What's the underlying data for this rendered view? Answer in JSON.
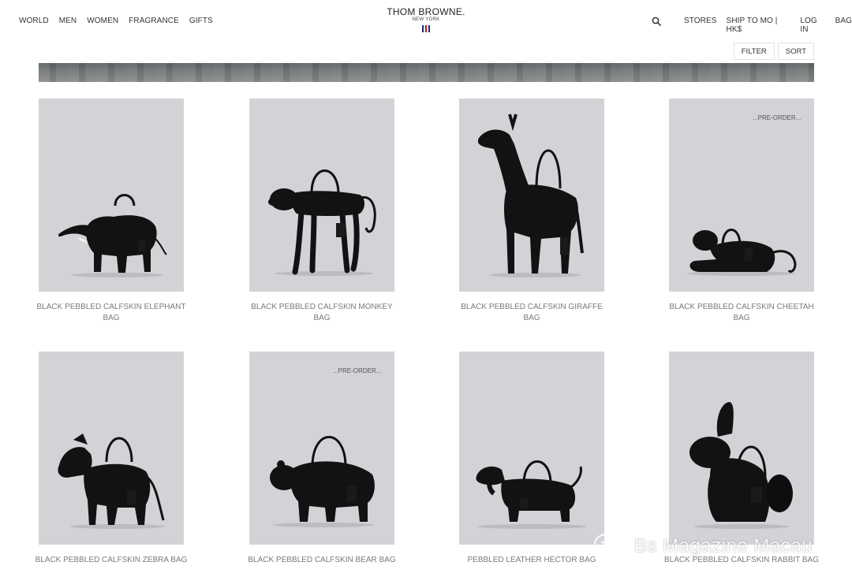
{
  "nav": {
    "left": [
      "WORLD",
      "MEN",
      "WOMEN",
      "FRAGRANCE",
      "GIFTS"
    ],
    "right": [
      "STORES",
      "SHIP TO MO | HK$",
      "LOG IN",
      "BAG"
    ]
  },
  "brand": {
    "name": "THOM BROWNE.",
    "sub": "NEW YORK"
  },
  "toolbar": {
    "filter": "FILTER",
    "sort": "SORT"
  },
  "products": [
    {
      "title": "BLACK PEBBLED CALFSKIN ELEPHANT BAG",
      "animal": "elephant",
      "badge": ""
    },
    {
      "title": "BLACK PEBBLED CALFSKIN MONKEY BAG",
      "animal": "monkey",
      "badge": ""
    },
    {
      "title": "BLACK PEBBLED CALFSKIN GIRAFFE BAG",
      "animal": "giraffe",
      "badge": ""
    },
    {
      "title": "BLACK PEBBLED CALFSKIN CHEETAH BAG",
      "animal": "cheetah",
      "badge": "...PRE-ORDER..."
    },
    {
      "title": "BLACK PEBBLED CALFSKIN ZEBRA BAG",
      "animal": "zebra",
      "badge": ""
    },
    {
      "title": "BLACK PEBBLED CALFSKIN BEAR BAG",
      "animal": "bear",
      "badge": "...PRE-ORDER..."
    },
    {
      "title": "PEBBLED LEATHER HECTOR BAG",
      "animal": "dachshund",
      "badge": ""
    },
    {
      "title": "BLACK PEBBLED CALFSKIN RABBIT BAG",
      "animal": "rabbit",
      "badge": ""
    }
  ],
  "watermark": {
    "text": "Bs Magazine Macau",
    "icon": "wechat-icon"
  },
  "colors": {
    "tile": "#d3d2d6",
    "product": "#111111",
    "title": "#7a7a7a"
  }
}
